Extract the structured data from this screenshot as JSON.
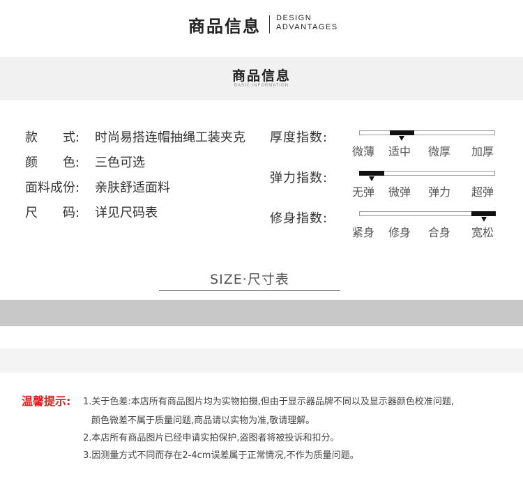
{
  "header": {
    "title_cn": "商品信息",
    "title_en_1": "DESIGN",
    "title_en_2": "ADVANTAGES"
  },
  "basic_info": {
    "title_cn": "商品信息",
    "title_en": "BASIC INFORMATION"
  },
  "attributes": [
    {
      "label": "款　　式:",
      "value": "时尚易搭连帽抽绳工装夹克"
    },
    {
      "label": "颜　　色:",
      "value": "三色可选"
    },
    {
      "label": "面料成份:",
      "value": "亲肤舒适面料"
    },
    {
      "label": "尺　　码:",
      "value": "详见尺码表"
    }
  ],
  "indices": [
    {
      "label": "厚度指数:",
      "options": [
        "微薄",
        "适中",
        "微厚",
        "加厚"
      ],
      "selected_index": 1
    },
    {
      "label": "弹力指数:",
      "options": [
        "无弹",
        "微弹",
        "弹力",
        "超弹"
      ],
      "selected_index": 0
    },
    {
      "label": "修身指数:",
      "options": [
        "紧身",
        "修身",
        "合身",
        "宽松"
      ],
      "selected_index": 3
    }
  ],
  "size_section": {
    "title": "SIZE·尺寸表"
  },
  "notice": {
    "title": "温馨提示:",
    "lines": [
      "1.关于色差:本店所有商品图片均为实物拍摄,但由于显示器品牌不同以及显示器颜色校准问题,",
      "颜色微差不属于质量问题,商品请以实物为准,敬请理解。",
      "2.本店所有商品图片已经申请实拍保护,盗图者将被投诉和扣分。",
      "3.因测量方式不同而存在2-4cm误差属于正常情况,不作为质量问题。"
    ]
  },
  "colors": {
    "band_light": "#f1f1f1",
    "band_gray": "#c8c8c8",
    "notice_accent": "#dd2222",
    "indicator": "#111111"
  }
}
